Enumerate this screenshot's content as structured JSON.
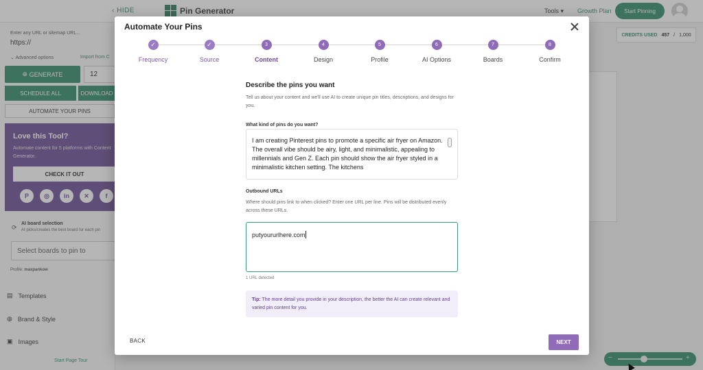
{
  "topbar": {
    "hide_label": "HIDE",
    "app_title": "Pin Generator",
    "tools_label": "Tools",
    "growth_plan_label": "Growth Plan",
    "start_pinning_label": "Start Pinning"
  },
  "sidebar": {
    "url_label": "Enter any URL or sitemap URL...",
    "url_value": "https://",
    "advanced_options_label": "Advanced options",
    "import_label": "Import from C",
    "generate_label": "GENERATE",
    "generate_count": "12",
    "schedule_all_label": "SCHEDULE ALL",
    "download_label": "DOWNLOAD",
    "automate_label": "AUTOMATE YOUR PINS",
    "promo": {
      "title": "Love this Tool?",
      "text": "Automate content for 5 platforms with Content Generator.",
      "button_label": "CHECK IT OUT"
    },
    "ai_board_title": "AI board selection",
    "ai_board_subtitle": "AI picks/creates the best board for each pin",
    "boards_placeholder": "Select boards to pin to",
    "profile_label": "Profile:",
    "profile_name": "maxpankow",
    "nav": {
      "templates": "Templates",
      "brand_style": "Brand & Style",
      "images": "Images"
    },
    "tour_label": "Start Page Tour"
  },
  "credits": {
    "label": "CREDITS USED",
    "used": "457",
    "separator": "/",
    "total": "1,000"
  },
  "zoom": {
    "level": 0.4
  },
  "modal": {
    "title": "Automate Your Pins",
    "steps": [
      {
        "number": "1",
        "label": "Frequency",
        "state": "done"
      },
      {
        "number": "2",
        "label": "Source",
        "state": "done"
      },
      {
        "number": "3",
        "label": "Content",
        "state": "active"
      },
      {
        "number": "4",
        "label": "Design",
        "state": "pending"
      },
      {
        "number": "5",
        "label": "Profile",
        "state": "pending"
      },
      {
        "number": "6",
        "label": "AI Options",
        "state": "pending"
      },
      {
        "number": "7",
        "label": "Boards",
        "state": "pending"
      },
      {
        "number": "8",
        "label": "Confirm",
        "state": "pending"
      }
    ],
    "section_title": "Describe the pins you want",
    "section_desc": "Tell us about your content and we'll use AI to create unique pin titles, descriptions, and designs for you.",
    "pins_field_label": "What kind of pins do you want?",
    "pins_field_value": "I am creating Pinterest pins to promote a specific air fryer on Amazon. The overall vibe should be airy, light, and minimalistic, appealing to millennials and Gen Z. Each pin should show the air fryer styled in a minimalistic kitchen setting. The kitchens",
    "urls_label": "Outbound URLs",
    "urls_desc": "Where should pins link to when clicked? Enter one URL per line. Pins will be distributed evenly across these URLs.",
    "urls_value": "putyoururlhere.com",
    "urls_detected": "1 URL detected",
    "tip_label": "Tip:",
    "tip_text": "The more detail you provide in your description, the better the AI can create relevant and varied pin content for you.",
    "back_label": "BACK",
    "next_label": "NEXT"
  },
  "colors": {
    "accent_purple": "#8f6bb8",
    "brand_green": "#2f8b68"
  }
}
